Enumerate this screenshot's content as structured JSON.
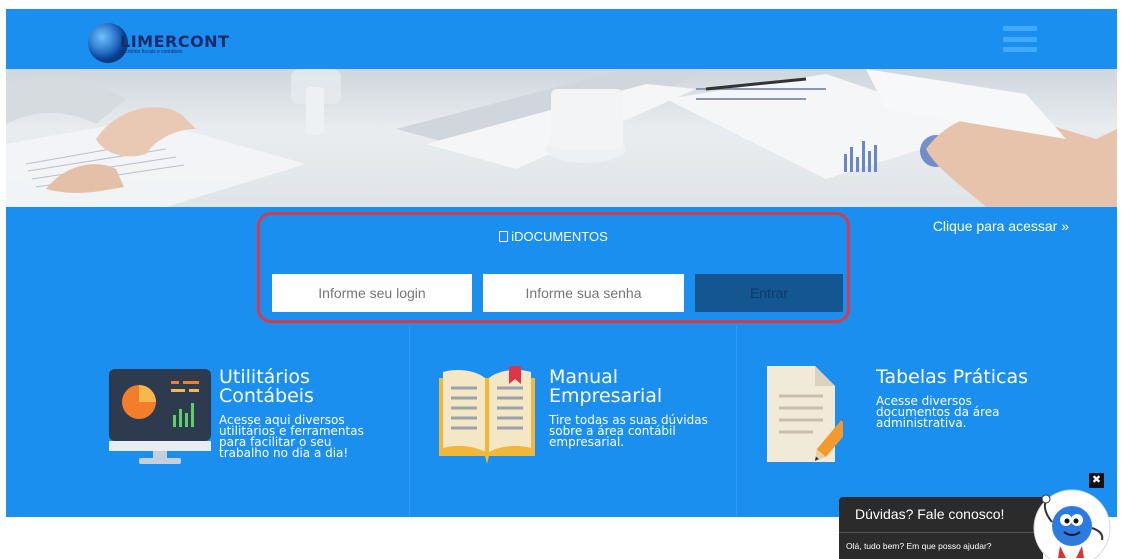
{
  "header": {
    "logo_name": "LIMERCONT",
    "logo_subtitle": "escritório fiscais e contábeis",
    "brand_color": "#1a8ff0",
    "menu_icon": "hamburger-menu-icon"
  },
  "login": {
    "title": "iDOCUMENTOS",
    "title_icon": "document-icon",
    "login_placeholder": "Informe seu login",
    "password_placeholder": "Informe sua senha",
    "enter_label": "Entrar",
    "access_link": "Clique para acessar »",
    "highlight_color": "#d93a4a"
  },
  "features": [
    {
      "title": "Utilitários Contábeis",
      "title_lines": [
        "Utilitários",
        "Contábeis"
      ],
      "description_lines": [
        "Acesse aqui diversos",
        "utilitários e ferramentas",
        "para facilitar o seu",
        "trabalho no dia a dia!"
      ],
      "icon": "monitor-chart-icon"
    },
    {
      "title": "Manual Empresarial",
      "title_lines": [
        "Manual",
        "Empresarial"
      ],
      "description_lines": [
        "Tire todas as suas dúvidas",
        "sobre a área contábil",
        "empresarial."
      ],
      "icon": "open-book-icon"
    },
    {
      "title": "Tabelas Práticas",
      "title_lines": [
        "Tabelas Práticas"
      ],
      "description_lines": [
        "Acesse diversos",
        "documentos da área",
        "administrativa."
      ],
      "icon": "document-pencil-icon"
    }
  ],
  "chat": {
    "close_label": "✖",
    "title": "Dúvidas? Fale conosco!",
    "message": "Olá, tudo bem? Em que posso ajudar?",
    "mascot_icon": "mascot-icon"
  }
}
